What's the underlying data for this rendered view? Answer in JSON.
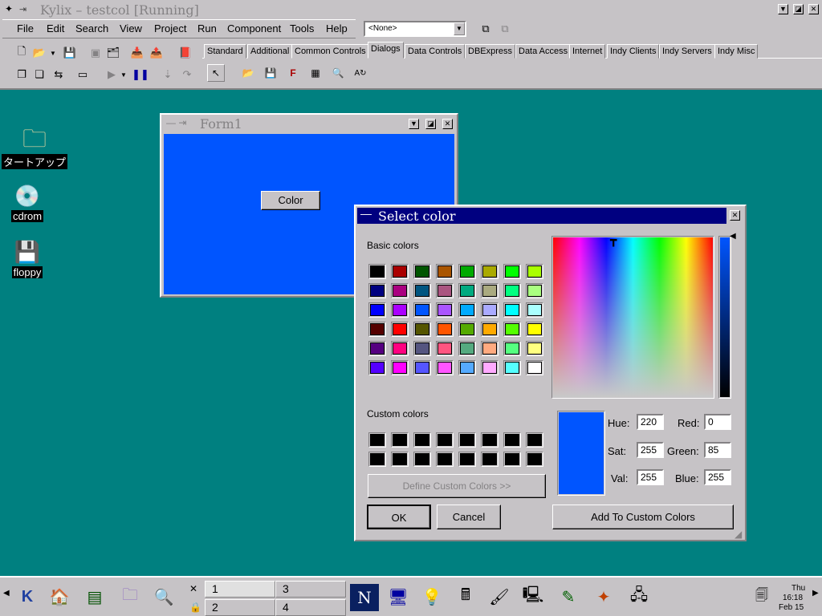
{
  "ide": {
    "title": "Kylix – testcol [Running]",
    "menu": [
      "File",
      "Edit",
      "Search",
      "View",
      "Project",
      "Run",
      "Component",
      "Tools",
      "Help"
    ],
    "menu_mnemonic": [
      "F",
      "E",
      "S",
      "V",
      "P",
      "R",
      "C",
      "T",
      "H"
    ],
    "combo_value": "<None>",
    "tabs": [
      "Standard",
      "Additional",
      "Common Controls",
      "Dialogs",
      "Data Controls",
      "DBExpress",
      "Data Access",
      "Internet",
      "Indy Clients",
      "Indy Servers",
      "Indy Misc"
    ],
    "active_tab": "Dialogs"
  },
  "desktop": {
    "icons": [
      {
        "label": "タートアップ",
        "icon": "folder-icon"
      },
      {
        "label": "cdrom",
        "icon": "cdrom-icon"
      },
      {
        "label": "floppy",
        "icon": "floppy-icon"
      }
    ]
  },
  "form1": {
    "title": "Form1",
    "button_label": "Color",
    "client_color": "#0055ff"
  },
  "color_dialog": {
    "title": "Select color",
    "basic_colors_label": "Basic colors",
    "custom_colors_label": "Custom colors",
    "define_custom_label": "Define Custom Colors >>",
    "ok_label": "OK",
    "cancel_label": "Cancel",
    "add_custom_label": "Add To Custom Colors",
    "hue_label": "Hue:",
    "hue": "220",
    "sat_label": "Sat:",
    "sat": "255",
    "val_label": "Val:",
    "val": "255",
    "red_label": "Red:",
    "red": "0",
    "green_label": "Green:",
    "green": "85",
    "blue_label": "Blue:",
    "blue": "255",
    "current_color": "#0055ff",
    "basic_colors": [
      "#000000",
      "#aa0000",
      "#005500",
      "#aa5500",
      "#00aa00",
      "#aaaa00",
      "#00ff00",
      "#aaff00",
      "#000080",
      "#aa0080",
      "#005580",
      "#aa5580",
      "#00aa80",
      "#aaaa80",
      "#00ff80",
      "#aaff80",
      "#0000ff",
      "#aa00ff",
      "#0055ff",
      "#aa55ff",
      "#00aaff",
      "#aaaaff",
      "#00ffff",
      "#aaffff",
      "#550000",
      "#ff0000",
      "#555500",
      "#ff5500",
      "#55aa00",
      "#ffaa00",
      "#55ff00",
      "#ffff00",
      "#550080",
      "#ff0080",
      "#555580",
      "#ff5580",
      "#55aa80",
      "#ffaa80",
      "#55ff80",
      "#ffff80",
      "#5500ff",
      "#ff00ff",
      "#5555ff",
      "#ff55ff",
      "#55aaff",
      "#ffaaff",
      "#55ffff",
      "#ffffff"
    ]
  },
  "taskbar": {
    "desktops": [
      "1",
      "2",
      "3",
      "4"
    ],
    "clock_day": "Thu",
    "clock_time": "16:18",
    "clock_date": "Feb 15"
  }
}
